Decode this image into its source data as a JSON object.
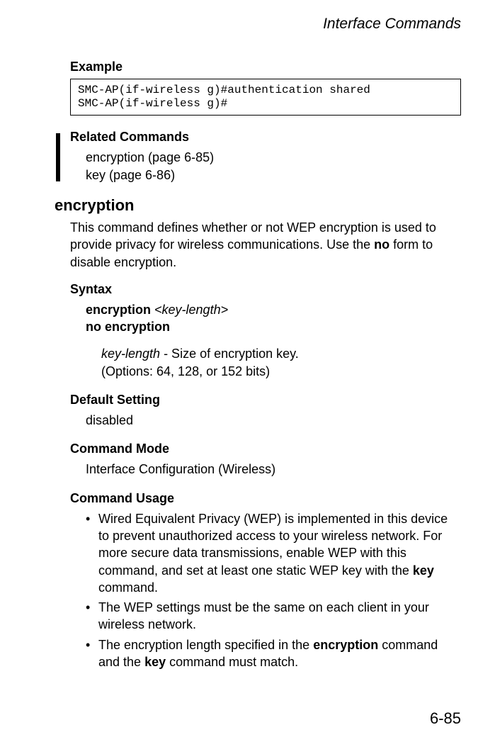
{
  "header": {
    "title": "Interface Commands"
  },
  "example": {
    "label": "Example",
    "code_line1": "SMC-AP(if-wireless g)#authentication shared",
    "code_line2": "SMC-AP(if-wireless g)#"
  },
  "related": {
    "label": "Related Commands",
    "line1": "encryption (page 6-85)",
    "line2": "key (page 6-86)"
  },
  "command": {
    "title": "encryption",
    "description_pre": "This command defines whether or not WEP encryption is used to provide privacy for wireless communications. Use the ",
    "description_bold": "no",
    "description_post": " form to disable encryption."
  },
  "syntax": {
    "label": "Syntax",
    "line1_bold": "encryption",
    "line1_italic": " <key-length>",
    "line2_bold": "no encryption",
    "param_italic": "key-length",
    "param_desc": " - Size of encryption key.",
    "param_options": "(Options: 64, 128, or 152 bits)"
  },
  "default": {
    "label": "Default Setting",
    "value": "disabled"
  },
  "mode": {
    "label": "Command Mode",
    "value": "Interface Configuration (Wireless)"
  },
  "usage": {
    "label": "Command Usage",
    "b1_a": "Wired Equivalent Privacy (WEP) is implemented in this device to prevent unauthorized access to your wireless network. For more secure data transmissions, enable WEP with this command, and set at least one static WEP key with the ",
    "b1_bold": "key",
    "b1_b": " command.",
    "b2": "The WEP settings must be the same on each client in your wireless network.",
    "b3_a": "The encryption length specified in the ",
    "b3_bold1": "encryption",
    "b3_b": " command and the ",
    "b3_bold2": "key",
    "b3_c": " command must match."
  },
  "footer": {
    "page": "6-85"
  }
}
